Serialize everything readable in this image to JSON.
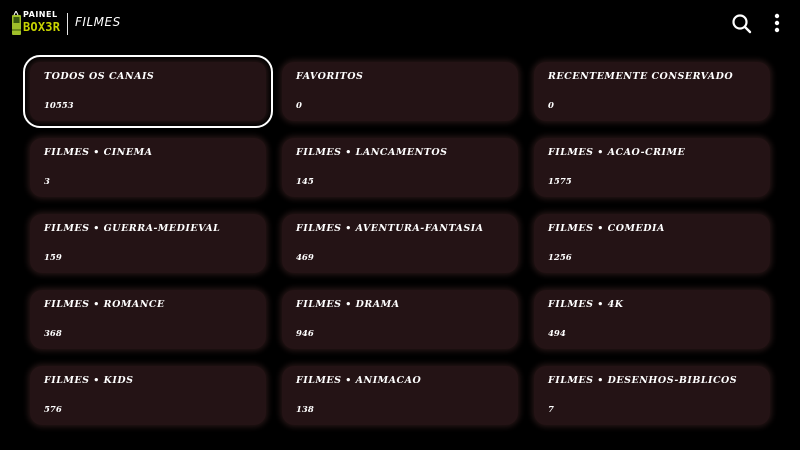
{
  "header": {
    "logo_line1": "PAINEL",
    "logo_line2": "BOX3R",
    "title": "FILMES",
    "logo_icon": "tv-box-icon",
    "search_icon": "search-icon",
    "menu_icon": "more-vert-icon"
  },
  "colors": {
    "background": "#000000",
    "card": "#241315",
    "logo_accent": "#c8d400",
    "selection": "#ffffff"
  },
  "categories": [
    {
      "label": "TODOS OS CANAIS",
      "count": "10553",
      "selected": true
    },
    {
      "label": "FAVORITOS",
      "count": "0"
    },
    {
      "label": "RECENTEMENTE CONSERVADO",
      "count": "0"
    },
    {
      "label": "FILMES • CINEMA",
      "count": "3"
    },
    {
      "label": "FILMES • LANCAMENTOS",
      "count": "145"
    },
    {
      "label": "FILMES • ACAO-CRIME",
      "count": "1575"
    },
    {
      "label": "FILMES • GUERRA-MEDIEVAL",
      "count": "159"
    },
    {
      "label": "FILMES • AVENTURA-FANTASIA",
      "count": "469"
    },
    {
      "label": "FILMES • COMEDIA",
      "count": "1256"
    },
    {
      "label": "FILMES • ROMANCE",
      "count": "368"
    },
    {
      "label": "FILMES • DRAMA",
      "count": "946"
    },
    {
      "label": "FILMES • 4K",
      "count": "494"
    },
    {
      "label": "FILMES • KIDS",
      "count": "576"
    },
    {
      "label": "FILMES • ANIMACAO",
      "count": "138"
    },
    {
      "label": "FILMES • DESENHOS-BIBLICOS",
      "count": "7"
    }
  ]
}
